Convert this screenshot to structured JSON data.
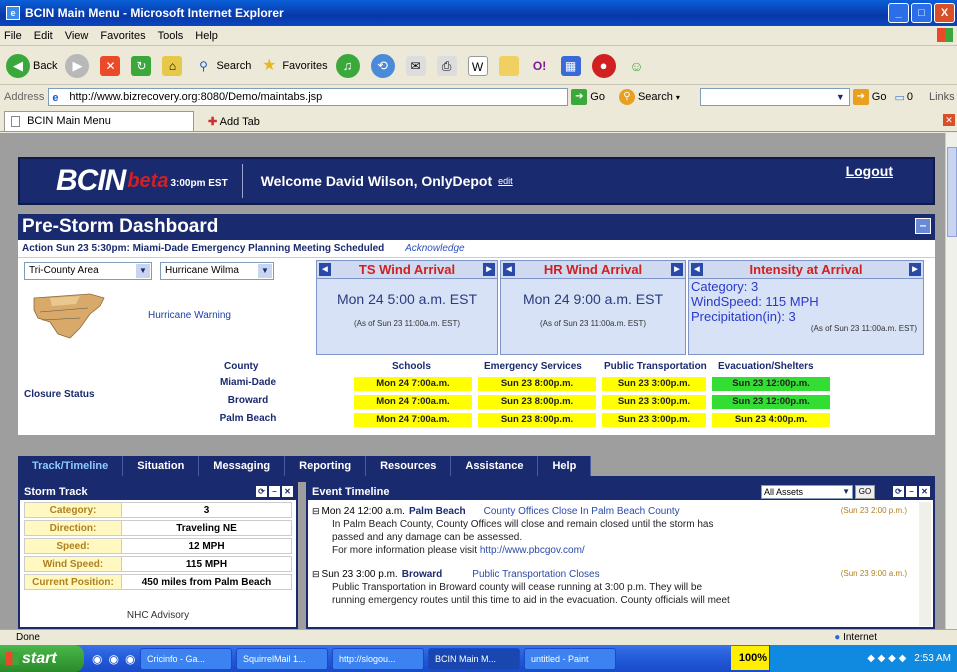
{
  "window": {
    "title": "BCIN Main Menu - Microsoft Internet Explorer",
    "controls": [
      "_",
      "□",
      "X"
    ]
  },
  "menu": [
    "File",
    "Edit",
    "View",
    "Favorites",
    "Tools",
    "Help"
  ],
  "toolbar": {
    "back": "Back",
    "search": "Search",
    "favorites": "Favorites"
  },
  "address": {
    "label": "Address",
    "url": "http://www.bizrecovery.org:8080/Demo/maintabs.jsp",
    "go": "Go",
    "search_label": "Search",
    "go2": "Go",
    "counter": "0",
    "links": "Links"
  },
  "tabs": {
    "current": "BCIN Main Menu",
    "add": "Add Tab"
  },
  "header": {
    "logo": "BCIN",
    "beta": "beta",
    "time": "3:00pm EST",
    "welcome": "Welcome David Wilson, OnlyDepot",
    "edit": "edit",
    "logout": "Logout"
  },
  "dashboard": {
    "title": "Pre-Storm Dashboard",
    "action": "Action Sun 23 5:30pm: Miami-Dade Emergency Planning Meeting Scheduled",
    "acknowledge": "Acknowledge"
  },
  "storm": {
    "area": "Tri-County Area",
    "hurricane": "Hurricane Wilma",
    "warning": "Hurricane Warning",
    "ts": {
      "title": "TS Wind Arrival",
      "time": "Mon 24 5:00 a.m. EST",
      "asof": "(As of Sun 23 11:00a.m. EST)"
    },
    "hr": {
      "title": "HR Wind Arrival",
      "time": "Mon 24 9:00 a.m. EST",
      "asof": "(As of Sun 23 11:00a.m. EST)"
    },
    "intensity": {
      "title": "Intensity at Arrival",
      "category": "Category: 3",
      "wind": "WindSpeed: 115 MPH",
      "precip": "Precipitation(in): 3",
      "asof": "(As of Sun 23 11:00a.m. EST)"
    }
  },
  "closure": {
    "label": "Closure Status",
    "headers": [
      "County",
      "Schools",
      "Emergency Services",
      "Public Transportation",
      "Evacuation/Shelters"
    ],
    "rows": [
      {
        "county": "Miami-Dade",
        "schools": "Mon 24 7:00a.m.",
        "emergency": "Sun 23 8:00p.m.",
        "transport": "Sun 23 3:00p.m.",
        "evac": "Sun 23 12:00p.m."
      },
      {
        "county": "Broward",
        "schools": "Mon 24 7:00a.m.",
        "emergency": "Sun 23 8:00p.m.",
        "transport": "Sun 23 3:00p.m.",
        "evac": "Sun 23 12:00p.m."
      },
      {
        "county": "Palm Beach",
        "schools": "Mon 24 7:00a.m.",
        "emergency": "Sun 23 8:00p.m.",
        "transport": "Sun 23 3:00p.m.",
        "evac": "Sun 23 4:00p.m."
      }
    ]
  },
  "pagetabs": [
    "Track/Timeline",
    "Situation",
    "Messaging",
    "Reporting",
    "Resources",
    "Assistance",
    "Help"
  ],
  "track": {
    "title": "Storm Track",
    "rows": [
      {
        "label": "Category:",
        "value": "3"
      },
      {
        "label": "Direction:",
        "value": "Traveling NE"
      },
      {
        "label": "Speed:",
        "value": "12 MPH"
      },
      {
        "label": "Wind Speed:",
        "value": "115 MPH"
      },
      {
        "label": "Current Position:",
        "value": "450 miles from Palm Beach"
      }
    ],
    "nhc": "NHC Advisory"
  },
  "timeline": {
    "title": "Event Timeline",
    "filter": "All Assets",
    "go": "GO",
    "events": [
      {
        "date": "Mon 24 12:00 a.m.",
        "county": "Palm Beach",
        "title": "County Offices Close In Palm Beach County",
        "ts": "(Sun 23 2:00 p.m.)",
        "body1": "In Palm Beach County, County Offices will close and remain closed until the storm has",
        "body2": "passed and any damage can be assessed.",
        "body3": "For more information please visit",
        "link": "http://www.pbcgov.com/"
      },
      {
        "date": "Sun 23 3:00 p.m.",
        "county": "Broward",
        "title": "Public Transportation Closes",
        "ts": "(Sun 23 9:00 a.m.)",
        "body1": "Public Transportation in Broward county will cease running at 3:00 p.m. They will be",
        "body2": "running emergency routes until this time to aid in the evacuation. County officials will meet"
      }
    ]
  },
  "status": {
    "done": "Done",
    "zone": "Internet"
  },
  "taskbar": {
    "start": "start",
    "items": [
      "Cricinfo - Ga...",
      "SquirrelMail 1...",
      "http://slogou...",
      "BCIN Main M...",
      "untitled - Paint"
    ],
    "zoom": "100%",
    "clock": "2:53 AM"
  },
  "colors": {
    "navy": "#1a2a6e",
    "yellow": "#ffff00",
    "green": "#33dd33",
    "red": "#d02020"
  }
}
